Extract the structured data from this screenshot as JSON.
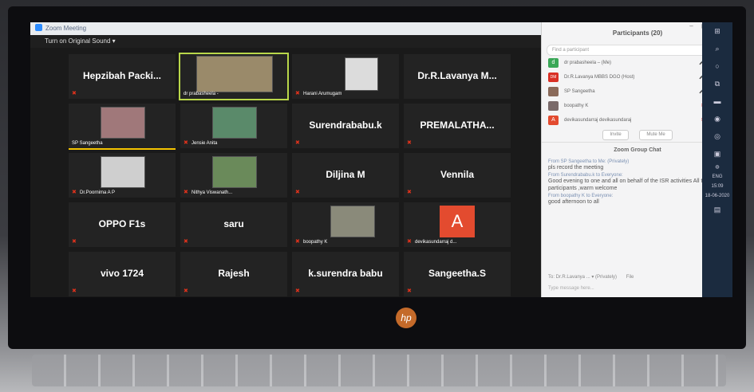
{
  "window": {
    "title": "Zoom Meeting",
    "sound_button": "Turn on Original Sound  ▾"
  },
  "tiles": [
    {
      "name": "Hepzibah  Packi...",
      "label": "",
      "mic": true
    },
    {
      "name": "",
      "label": "dr prabasheela -",
      "mic": false
    },
    {
      "name": "",
      "label": "Harani Arumugam",
      "mic": true
    },
    {
      "name": "Dr.R.Lavanya  M...",
      "label": "",
      "mic": false
    },
    {
      "name": "",
      "label": "SP Sangeetha",
      "mic": false
    },
    {
      "name": "",
      "label": "Jensie Anita",
      "mic": true
    },
    {
      "name": "Surendrababu.k",
      "label": "",
      "mic": true
    },
    {
      "name": "PREMALATHA...",
      "label": "",
      "mic": true
    },
    {
      "name": "",
      "label": "Dr.Poornima A P",
      "mic": true
    },
    {
      "name": "",
      "label": "Nithya Viswanath...",
      "mic": true
    },
    {
      "name": "Diljina M",
      "label": "",
      "mic": true
    },
    {
      "name": "Vennila",
      "label": "",
      "mic": true
    },
    {
      "name": "OPPO F1s",
      "label": "",
      "mic": true
    },
    {
      "name": "saru",
      "label": "",
      "mic": true
    },
    {
      "name": "",
      "label": "boopathy K",
      "mic": true
    },
    {
      "name": "",
      "label": "devikasundarraj d...",
      "mic": true,
      "letter": "A"
    },
    {
      "name": "vivo 1724",
      "label": "",
      "mic": true
    },
    {
      "name": "Rajesh",
      "label": "",
      "mic": true
    },
    {
      "name": "k.surendra babu",
      "label": "",
      "mic": true
    },
    {
      "name": "Sangeetha.S",
      "label": "",
      "mic": true
    }
  ],
  "participants": {
    "title": "Participants (20)",
    "search_placeholder": "Find a participant",
    "rows": [
      {
        "initials": "d",
        "color": "#3aa757",
        "name": "dr prabasheela – (Me)"
      },
      {
        "initials": "DM",
        "color": "#d93025",
        "name": "Dr.R.Lavanya MBBS DGO (Host)"
      },
      {
        "initials": "",
        "color": "#8a6a5a",
        "name": "SP Sangeetha"
      },
      {
        "initials": "",
        "color": "#7a6a6a",
        "name": "boopathy K"
      },
      {
        "initials": "A",
        "color": "#e34b2f",
        "name": "devikasundarraj devikasundaraj"
      }
    ],
    "invite": "Invite",
    "mute_me": "Mute Me"
  },
  "chat": {
    "title": "Zoom Group Chat",
    "messages": [
      {
        "from": "From SP Sangeetha to Me: (Privately)",
        "text": "pls record the meeting"
      },
      {
        "from": "From Surendrababu.k to Everyone:",
        "text": "Good evening to one and all on behalf of the ISR activities All the participants ,warm welcome"
      },
      {
        "from": "From boopathy K to Everyone:",
        "text": "good afternoon to all"
      }
    ],
    "to_line": "To:  Dr.R.Lavanya ... ▾   (Privately)",
    "file": "File",
    "input_placeholder": "Type message here..."
  },
  "taskbar": {
    "lang": "ENG",
    "time": "15:09",
    "date": "18-06-2020"
  },
  "brand": "hp"
}
